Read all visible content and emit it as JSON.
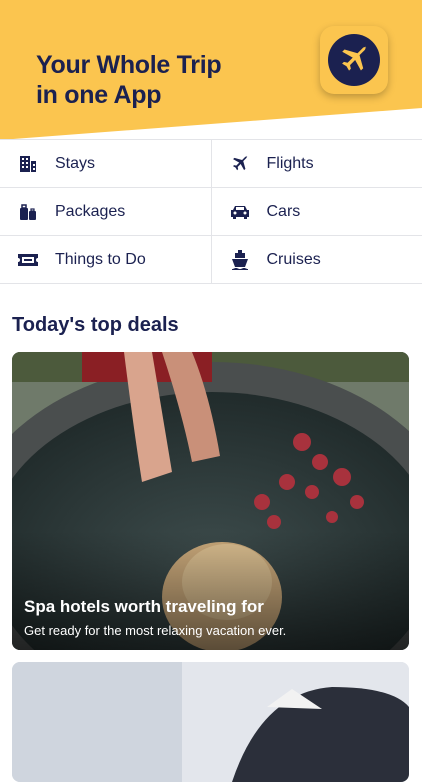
{
  "header": {
    "tagline_line1": "Your Whole Trip",
    "tagline_line2": "in one App",
    "accent_color": "#fbc54f",
    "brand_color": "#1b2150",
    "app_icon": "plane-icon"
  },
  "categories": [
    {
      "label": "Stays",
      "icon": "building-icon"
    },
    {
      "label": "Flights",
      "icon": "plane-icon"
    },
    {
      "label": "Packages",
      "icon": "luggage-icon"
    },
    {
      "label": "Cars",
      "icon": "car-icon"
    },
    {
      "label": "Things to Do",
      "icon": "ticket-icon"
    },
    {
      "label": "Cruises",
      "icon": "ship-icon"
    }
  ],
  "deals": {
    "section_title": "Today's top deals",
    "items": [
      {
        "title": "Spa hotels worth traveling for",
        "subtitle": "Get ready for the most relaxing vacation ever."
      }
    ]
  }
}
